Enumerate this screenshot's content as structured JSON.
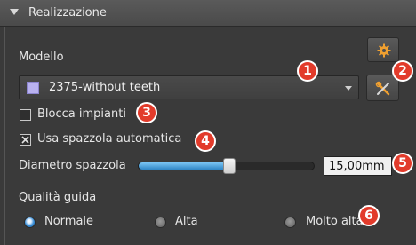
{
  "header": {
    "title": "Realizzazione"
  },
  "model": {
    "label": "Modello",
    "selected": "2375-without teeth",
    "swatch_color": "#b9b2f0"
  },
  "options": {
    "block_implants": {
      "label": "Blocca impianti",
      "checked": false
    },
    "auto_brush": {
      "label": "Usa spazzola automatica",
      "checked": true
    }
  },
  "brush_diameter": {
    "label": "Diametro spazzola",
    "value_text": "15,00mm",
    "slider_fraction": 0.52
  },
  "guide_quality": {
    "label": "Qualità guida",
    "options": [
      {
        "label": "Normale",
        "selected": true
      },
      {
        "label": "Alta",
        "selected": false
      },
      {
        "label": "Molto alta",
        "selected": false
      }
    ]
  },
  "badges": [
    "1",
    "2",
    "3",
    "4",
    "5",
    "6"
  ],
  "icons": {
    "gear": "gear-icon",
    "tools": "tools-icon",
    "collapse": "collapse-triangle-icon"
  },
  "colors": {
    "accent_blue": "#2f86c6",
    "badge_red": "#e23b2b",
    "gear_orange": "#f0a030"
  }
}
